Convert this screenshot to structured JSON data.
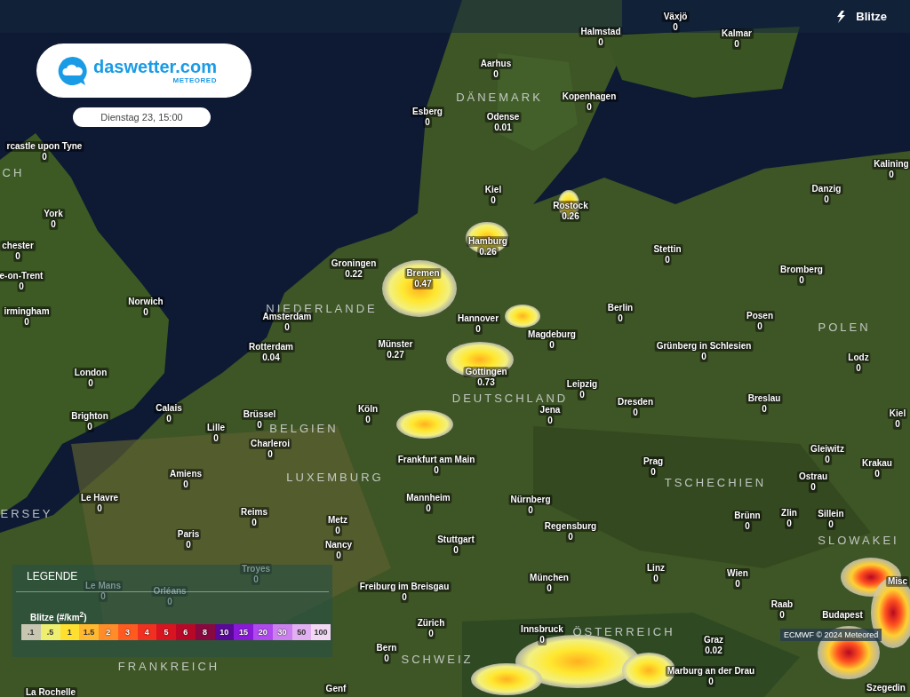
{
  "top_bar": {
    "layer_label": "Blitze"
  },
  "logo": {
    "name": "daswetter.com",
    "sub": "METEORED"
  },
  "date": "Dienstag 23, 15:00",
  "countries": [
    "DÄNEMARK",
    "NIEDERLANDE",
    "DEUTSCHLAND",
    "BELGIEN",
    "LUXEMBURG",
    "POLEN",
    "TSCHECHIEN",
    "SLOWAKEI",
    "ÖSTERREICH",
    "SCHWEIZ",
    "FRANKREICH",
    "ERSEY",
    "CH"
  ],
  "cities": [
    {
      "name": "Växjö",
      "value": "0"
    },
    {
      "name": "Halmstad",
      "value": "0"
    },
    {
      "name": "Kalmar",
      "value": "0"
    },
    {
      "name": "Aarhus",
      "value": "0"
    },
    {
      "name": "Kopenhagen",
      "value": "0"
    },
    {
      "name": "Odense",
      "value": "0.01"
    },
    {
      "name": "Esberg",
      "value": "0"
    },
    {
      "name": "Kiel",
      "value": "0"
    },
    {
      "name": "Rostock",
      "value": "0.26"
    },
    {
      "name": "Hamburg",
      "value": "0.26"
    },
    {
      "name": "Stettin",
      "value": "0"
    },
    {
      "name": "Danzig",
      "value": "0"
    },
    {
      "name": "Kalining",
      "value": "0"
    },
    {
      "name": "Bromberg",
      "value": "0"
    },
    {
      "name": "Groningen",
      "value": "0.22"
    },
    {
      "name": "Bremen",
      "value": "0.47"
    },
    {
      "name": "Hannover",
      "value": "0"
    },
    {
      "name": "Berlin",
      "value": "0"
    },
    {
      "name": "Magdeburg",
      "value": "0"
    },
    {
      "name": "Posen",
      "value": "0"
    },
    {
      "name": "Grünberg in Schlesien",
      "value": "0"
    },
    {
      "name": "Amsterdam",
      "value": "0"
    },
    {
      "name": "Rotterdam",
      "value": "0.04"
    },
    {
      "name": "Münster",
      "value": "0.27"
    },
    {
      "name": "Göttingen",
      "value": "0.73"
    },
    {
      "name": "Leipzig",
      "value": "0"
    },
    {
      "name": "Jena",
      "value": "0"
    },
    {
      "name": "Dresden",
      "value": "0"
    },
    {
      "name": "Breslau",
      "value": "0"
    },
    {
      "name": "Lodz",
      "value": "0"
    },
    {
      "name": "Kiel",
      "value": "0"
    },
    {
      "name": "rcastle upon Tyne",
      "value": "0"
    },
    {
      "name": "Norwich",
      "value": "0"
    },
    {
      "name": "York",
      "value": "0"
    },
    {
      "name": "chester",
      "value": "0"
    },
    {
      "name": "e-on-Trent",
      "value": "0"
    },
    {
      "name": "irmingham",
      "value": "0"
    },
    {
      "name": "London",
      "value": "0"
    },
    {
      "name": "Brighton",
      "value": "0"
    },
    {
      "name": "Calais",
      "value": "0"
    },
    {
      "name": "Lille",
      "value": "0"
    },
    {
      "name": "Brüssel",
      "value": "0"
    },
    {
      "name": "Charleroi",
      "value": "0"
    },
    {
      "name": "Köln",
      "value": "0"
    },
    {
      "name": "Frankfurt am Main",
      "value": "0"
    },
    {
      "name": "Amiens",
      "value": "0"
    },
    {
      "name": "Le Havre",
      "value": "0"
    },
    {
      "name": "Reims",
      "value": "0"
    },
    {
      "name": "Paris",
      "value": "0"
    },
    {
      "name": "Metz",
      "value": "0"
    },
    {
      "name": "Nancy",
      "value": "0"
    },
    {
      "name": "Mannheim",
      "value": "0"
    },
    {
      "name": "Stuttgart",
      "value": "0"
    },
    {
      "name": "Troyes",
      "value": "0"
    },
    {
      "name": "Le Mans",
      "value": "0"
    },
    {
      "name": "Orléans",
      "value": "0"
    },
    {
      "name": "Freiburg im Breisgau",
      "value": "0"
    },
    {
      "name": "Zürich",
      "value": "0"
    },
    {
      "name": "Bern",
      "value": "0"
    },
    {
      "name": "Genf"
    },
    {
      "name": "La Rochelle"
    },
    {
      "name": "Prag",
      "value": "0"
    },
    {
      "name": "Nürnberg",
      "value": "0"
    },
    {
      "name": "Regensburg",
      "value": "0"
    },
    {
      "name": "München",
      "value": "0"
    },
    {
      "name": "Linz",
      "value": "0"
    },
    {
      "name": "Wien",
      "value": "0"
    },
    {
      "name": "Gleiwitz",
      "value": "0"
    },
    {
      "name": "Krakau",
      "value": "0"
    },
    {
      "name": "Ostrau",
      "value": "0"
    },
    {
      "name": "Brünn",
      "value": "0"
    },
    {
      "name": "Zlin",
      "value": "0"
    },
    {
      "name": "Sillein",
      "value": "0"
    },
    {
      "name": "Raab",
      "value": "0"
    },
    {
      "name": "Budapest"
    },
    {
      "name": "Innsbruck",
      "value": "0"
    },
    {
      "name": "Graz",
      "value": "0.02"
    },
    {
      "name": "Marburg an der Drau",
      "value": "0"
    },
    {
      "name": "Misc"
    },
    {
      "name": "Szegedin"
    }
  ],
  "legend": {
    "title": "LEGENDE",
    "unit": "Blitze (#/km$^{2}$)",
    "stops": [
      {
        "label": ".1",
        "color": "#c8c6b0"
      },
      {
        "label": ".5",
        "color": "#eeee70"
      },
      {
        "label": "1",
        "color": "#ffe030"
      },
      {
        "label": "1.5",
        "color": "#ffb830"
      },
      {
        "label": "2",
        "color": "#ff8c28"
      },
      {
        "label": "3",
        "color": "#ff5a20"
      },
      {
        "label": "4",
        "color": "#f03020"
      },
      {
        "label": "5",
        "color": "#d81420"
      },
      {
        "label": "6",
        "color": "#b80828"
      },
      {
        "label": "8",
        "color": "#880840"
      },
      {
        "label": "10",
        "color": "#5a0898"
      },
      {
        "label": "15",
        "color": "#8a18d8"
      },
      {
        "label": "20",
        "color": "#b048f0"
      },
      {
        "label": "30",
        "color": "#cc80f0"
      },
      {
        "label": "50",
        "color": "#e2b0f2"
      },
      {
        "label": "100",
        "color": "#f2d8f4"
      }
    ]
  },
  "attribution": "ECMWF © 2024 Meteored"
}
